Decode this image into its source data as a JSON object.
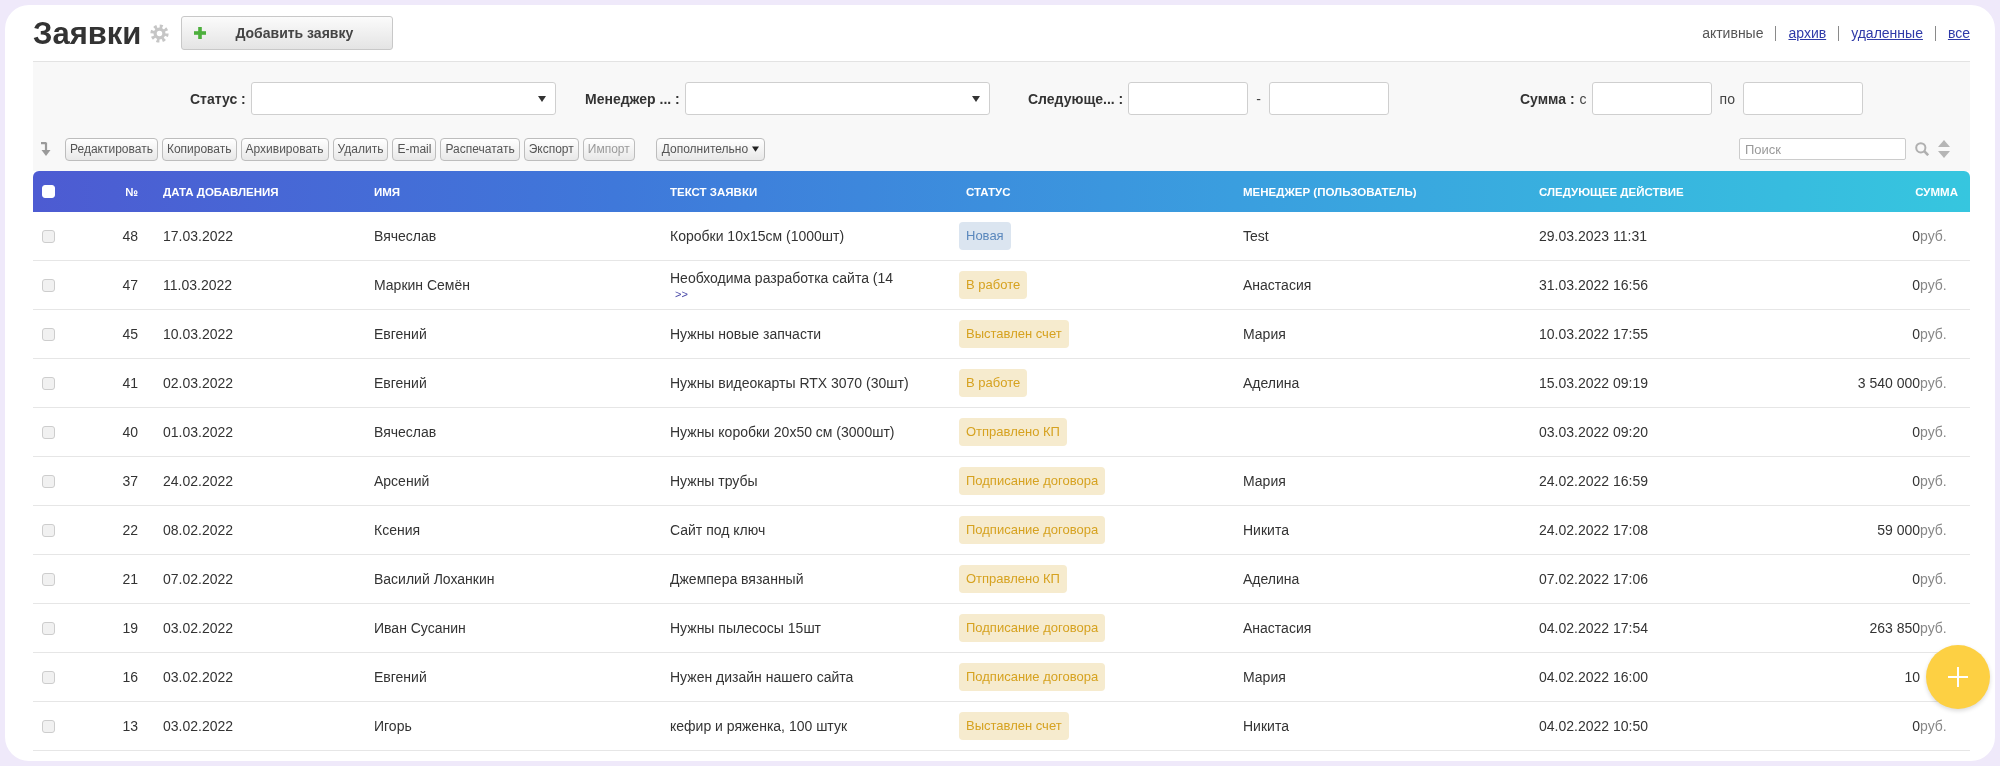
{
  "header": {
    "title": "Заявки",
    "add_button": "Добавить заявку"
  },
  "views": [
    {
      "label": "активные",
      "selected": true
    },
    {
      "label": "архив",
      "selected": false
    },
    {
      "label": "удаленные",
      "selected": false
    },
    {
      "label": "все",
      "selected": false
    }
  ],
  "filters": [
    {
      "kind": "select",
      "label": "Статус :"
    },
    {
      "kind": "select",
      "label": "Менеджер ... :"
    },
    {
      "kind": "range",
      "label": "Следующе... :",
      "between": "-"
    },
    {
      "kind": "range",
      "label": "Сумма :",
      "before": "с",
      "between": "по"
    }
  ],
  "toolbar": {
    "buttons": [
      {
        "label": "Редактировать",
        "disabled": false
      },
      {
        "label": "Копировать",
        "disabled": false
      },
      {
        "label": "Архивировать",
        "disabled": false
      },
      {
        "label": "Удалить",
        "disabled": false
      },
      {
        "label": "E-mail",
        "disabled": false
      },
      {
        "label": "Распечатать",
        "disabled": false
      },
      {
        "label": "Экспорт",
        "disabled": false
      },
      {
        "label": "Импорт",
        "disabled": true
      }
    ],
    "more": "Дополнительно"
  },
  "search": {
    "placeholder": "Поиск"
  },
  "table": {
    "select_all": {
      "checked": false
    },
    "columns": [
      "№",
      "ДАТА ДОБАВЛЕНИЯ",
      "ИМЯ",
      "ТЕКСТ ЗАЯВКИ",
      "СТАТУС",
      "МЕНЕДЖЕР (ПОЛЬЗОВАТЕЛЬ)",
      "СЛЕДУЮЩЕЕ ДЕЙСТВИЕ",
      "СУММА"
    ],
    "rows": [
      {
        "checked": false,
        "number": "48",
        "date": "17.03.2022",
        "name": "Вячеслав",
        "text": "Коробки 10x15см (1000шт)",
        "status": {
          "label": "Новая",
          "color": "#5a88bd"
        },
        "manager": "Test",
        "next_action": "29.03.2023 11:31",
        "amount": "0",
        "currency": "руб."
      },
      {
        "checked": false,
        "number": "47",
        "date": "11.03.2022",
        "name": "Маркин Семён",
        "text": "Необходима разработка сайта (14",
        "more": ">>",
        "status": {
          "label": "В работе",
          "color": "#d6a220"
        },
        "manager": "Анастасия",
        "next_action": "31.03.2022 16:56",
        "amount": "0",
        "currency": "руб."
      },
      {
        "checked": false,
        "number": "45",
        "date": "10.03.2022",
        "name": "Евгений",
        "text": "Нужны новые запчасти",
        "status": {
          "label": "Выставлен счет",
          "color": "#d6a220"
        },
        "manager": "Мария",
        "next_action": "10.03.2022 17:55",
        "amount": "0",
        "currency": "руб."
      },
      {
        "checked": false,
        "number": "41",
        "date": "02.03.2022",
        "name": "Евгений",
        "text": "Нужны видеокарты RTX 3070 (30шт)",
        "status": {
          "label": "В работе",
          "color": "#d6a220"
        },
        "manager": "Аделина",
        "next_action": "15.03.2022 09:19",
        "amount": "3 540 000",
        "currency": "руб."
      },
      {
        "checked": false,
        "number": "40",
        "date": "01.03.2022",
        "name": "Вячеслав",
        "text": "Нужны коробки 20x50 см (3000шт)",
        "status": {
          "label": "Отправлено КП",
          "color": "#d6a220"
        },
        "next_action": "03.03.2022 09:20",
        "amount": "0",
        "currency": "руб."
      },
      {
        "checked": false,
        "number": "37",
        "date": "24.02.2022",
        "name": "Арсений",
        "text": "Нужны трубы",
        "status": {
          "label": "Подписание договора",
          "color": "#d6a220"
        },
        "manager": "Мария",
        "next_action": "24.02.2022 16:59",
        "amount": "0",
        "currency": "руб."
      },
      {
        "checked": false,
        "number": "22",
        "date": "08.02.2022",
        "name": "Ксения",
        "text": "Сайт под ключ",
        "status": {
          "label": "Подписание договора",
          "color": "#d6a220"
        },
        "manager": "Никита",
        "next_action": "24.02.2022 17:08",
        "amount": "59 000",
        "currency": "руб."
      },
      {
        "checked": false,
        "number": "21",
        "date": "07.02.2022",
        "name": "Василий Лоханкин",
        "text": "Джемпера вязанный",
        "status": {
          "label": "Отправлено КП",
          "color": "#d6a220"
        },
        "manager": "Аделина",
        "next_action": "07.02.2022 17:06",
        "amount": "0",
        "currency": "руб."
      },
      {
        "checked": false,
        "number": "19",
        "date": "03.02.2022",
        "name": "Иван Сусанин",
        "text": "Нужны пылесосы 15шт",
        "status": {
          "label": "Подписание договора",
          "color": "#d6a220"
        },
        "manager": "Анастасия",
        "next_action": "04.02.2022 17:54",
        "amount": "263 850",
        "currency": "руб."
      },
      {
        "checked": false,
        "number": "16",
        "date": "03.02.2022",
        "name": "Евгений",
        "text": "Нужен дизайн нашего сайта",
        "status": {
          "label": "Подписание договора",
          "color": "#d6a220"
        },
        "manager": "Мария",
        "next_action": "04.02.2022 16:00",
        "amount": "10"
      },
      {
        "checked": false,
        "number": "13",
        "date": "03.02.2022",
        "name": "Игорь",
        "text": "кефир и ряженка, 100 штук",
        "status": {
          "label": "Выставлен счет",
          "color": "#d6a220"
        },
        "manager": "Никита",
        "next_action": "04.02.2022 10:50",
        "amount": "0",
        "currency": "руб."
      }
    ]
  }
}
